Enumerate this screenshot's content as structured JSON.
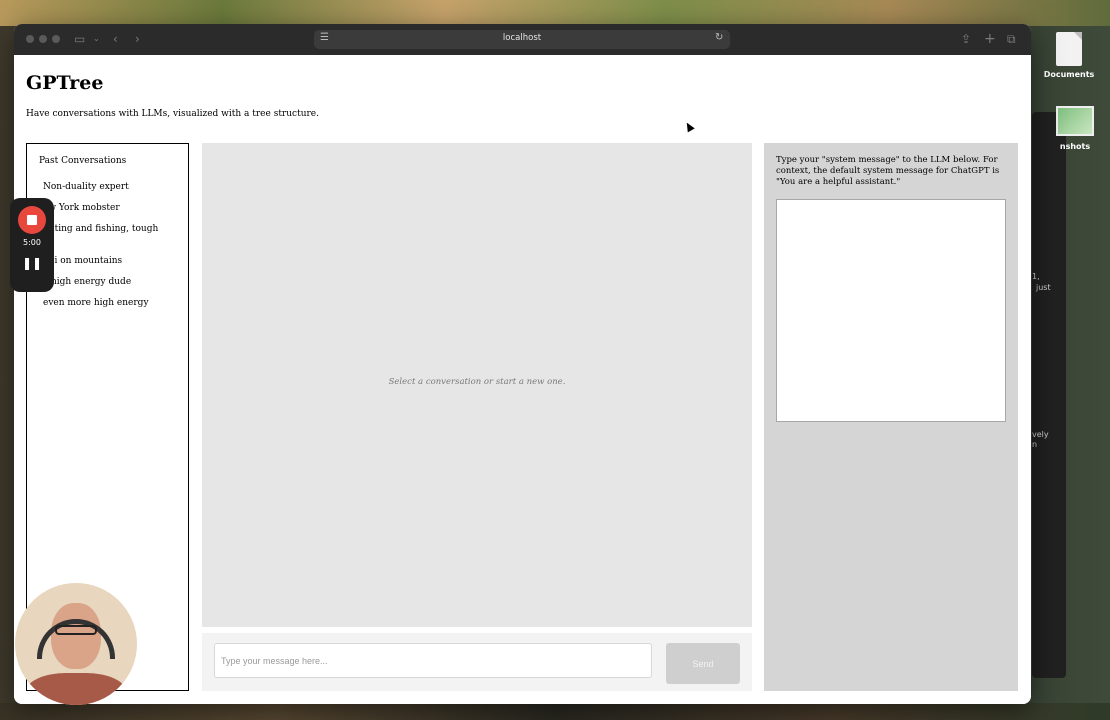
{
  "browser": {
    "url": "localhost"
  },
  "desktop": {
    "icons": [
      {
        "label": "Documents"
      },
      {
        "label": "nshots"
      }
    ],
    "background_text": [
      "1,",
      "just",
      "vely",
      "n"
    ]
  },
  "app": {
    "title": "GPTree",
    "subtitle": "Have conversations with LLMs, visualized with a tree structure."
  },
  "sidebar": {
    "title": "Past Conversations",
    "items": [
      {
        "label": "Non-duality expert"
      },
      {
        "label": "ew York mobster"
      },
      {
        "label": "unting and fishing, tough\nve"
      },
      {
        "label": "bbi on mountains"
      },
      {
        "label": "y high energy dude"
      },
      {
        "label": "even more high energy"
      }
    ]
  },
  "chat": {
    "empty_text": "Select a conversation or start a new one.",
    "input_placeholder": "Type your message here...",
    "send_label": "Send"
  },
  "system": {
    "label": "Type your \"system message\" to the LLM below. For context, the default system message for ChatGPT is \"You are a helpful assistant.\""
  },
  "recorder": {
    "time": "5:00"
  },
  "colors": {
    "chat_bg": "#e6e6e6",
    "system_bg": "#d5d5d5",
    "record_red": "#e8473e",
    "send_disabled": "#cfcfcf"
  }
}
